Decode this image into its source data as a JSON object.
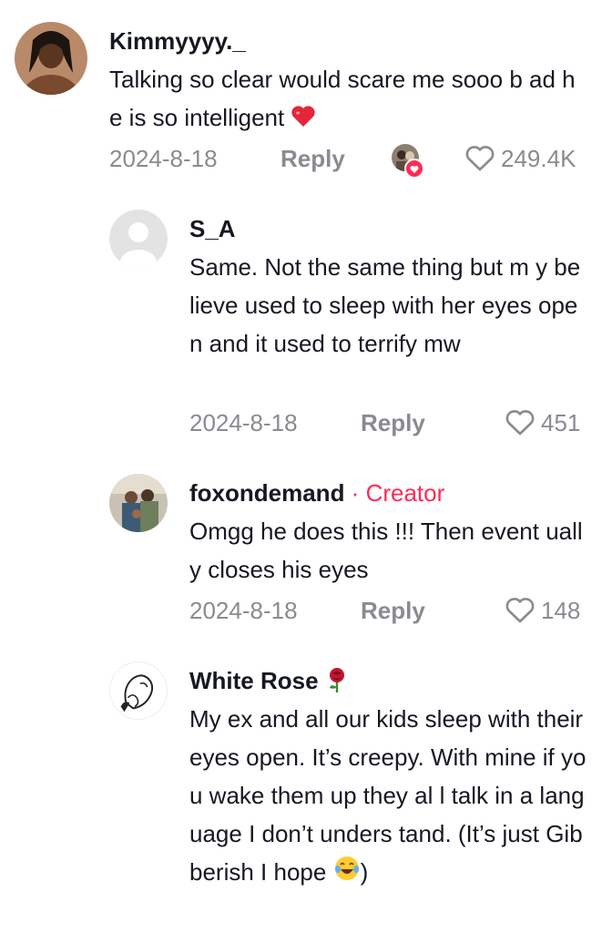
{
  "comments": [
    {
      "username": "Kimmyyyy._",
      "text": "Talking so clear would scare me sooo b ad he is so intelligent",
      "emoji": "heart-emoji",
      "date": "2024-8-18",
      "reply_label": "Reply",
      "likes": "249.4K",
      "liked_by_creator": true
    },
    {
      "username": "S_A",
      "text": "Same. Not the same thing but m y believe used to sleep with her eyes open and it used to terrify mw",
      "date": "2024-8-18",
      "reply_label": "Reply",
      "likes": "451"
    },
    {
      "username": "foxondemand",
      "separator": " · ",
      "badge": "Creator",
      "text": "Omgg he does this !!! Then event ually closes his eyes",
      "date": "2024-8-18",
      "reply_label": "Reply",
      "likes": "148"
    },
    {
      "username": "White Rose",
      "username_emoji": "rose-emoji",
      "text": "My ex and all our kids sleep with their eyes open. It’s creepy. With mine if you wake them up they al l talk in a language I don’t unders tand. (It’s just Gibberish I hope",
      "text_end": ")",
      "text_emoji": "laughing-emoji"
    }
  ],
  "colors": {
    "primary_text": "#161823",
    "secondary_text": "#8a8b91",
    "accent": "#fe2c55"
  }
}
